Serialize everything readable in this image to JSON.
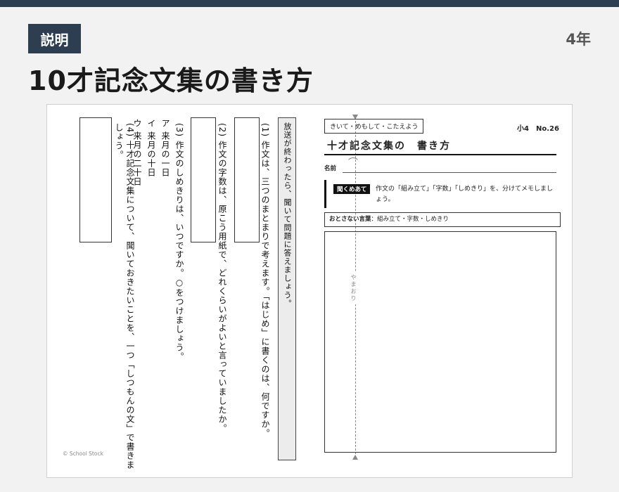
{
  "header": {
    "badge": "説明",
    "grade": "4年",
    "title": "10才記念文集の書き方"
  },
  "worksheet": {
    "questions": {
      "q1_line1": "(1) 作文は、三つのまとまりで考えます。「はじめ」に書くのは、何ですか。",
      "q2_line1": "(2) 作文の字数は、原こう用紙で、どれくらいがよいと言っていましたか。",
      "q3_line1": "(3) 作文のしめきりは、いつですか。○をつけましょう。",
      "q3_a": "ア 来月の一日",
      "q3_i": "イ 来月の十日",
      "q3_u": "ウ 来月の二十日",
      "q4_line1": "(4) 十才記念文集について、聞いておきたいことを、一つ「しつもんの文」で書きましょう。"
    },
    "instruction": "放送が終わったら、聞いて問題に答えましょう。",
    "fold_label": "やまおり",
    "tag_label": "きいて・めもして・こたえよう",
    "worksheet_number": "小4　No.26",
    "title": "十才記念文集の　書き方",
    "name_label": "名前",
    "aim": {
      "label": "聞くめあて",
      "text": "作文の「組み立て」「字数」「しめきり」を、分けてメモしましょう。"
    },
    "keywords": {
      "label": "おとさない言葉",
      "text": "：組み立て・字数・しめきり"
    },
    "copyright": "© School Stock"
  }
}
